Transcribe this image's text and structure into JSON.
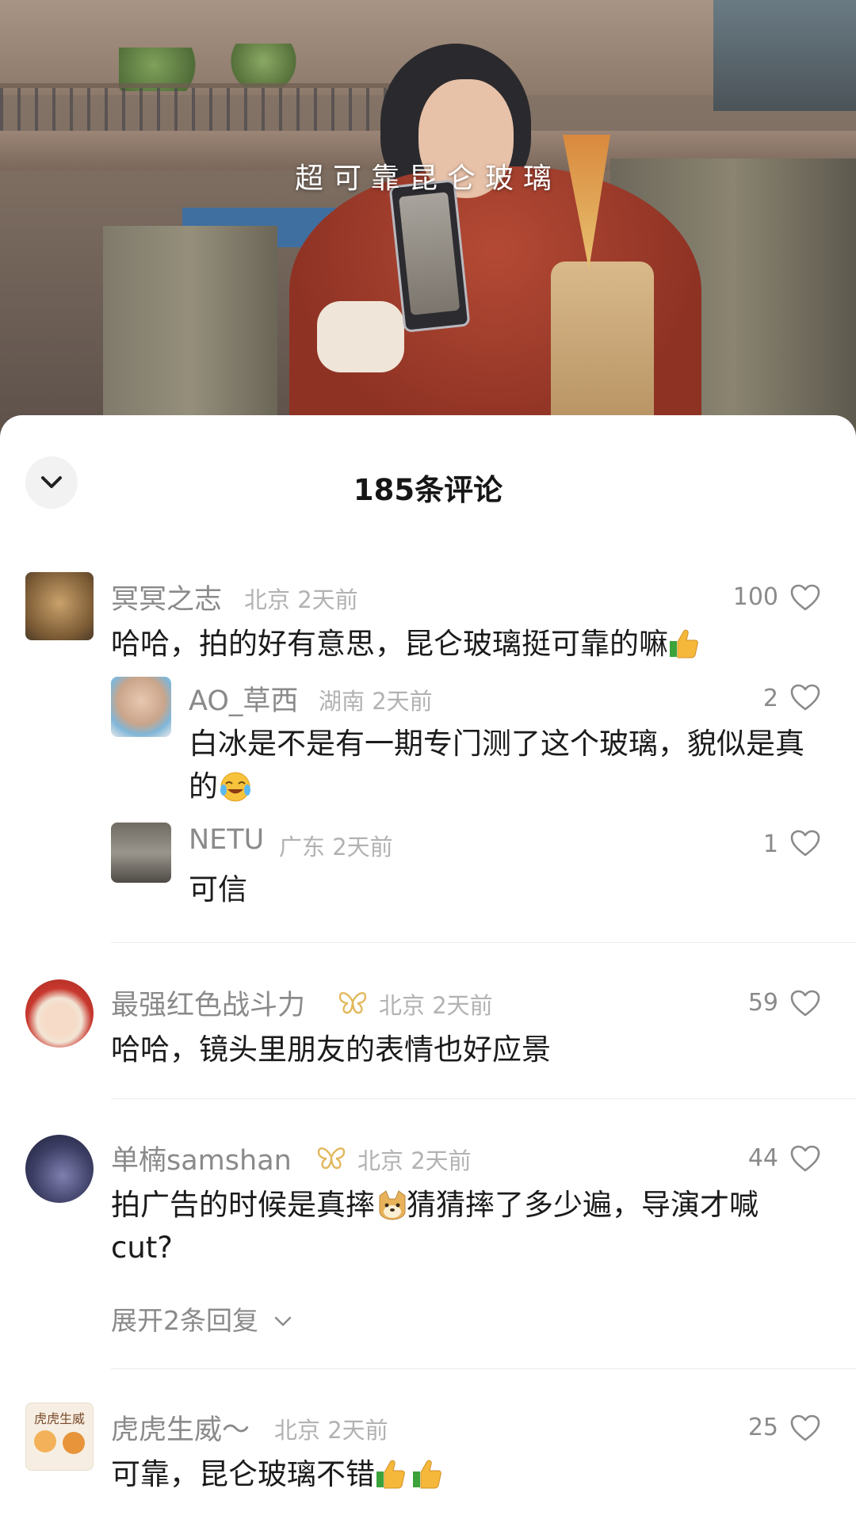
{
  "video": {
    "overlay_text": "超可靠昆仑玻璃"
  },
  "sheet": {
    "title": "185条评论"
  },
  "comments": [
    {
      "user": "冥冥之志",
      "location": "北京",
      "time": "2天前",
      "likes": "100",
      "text": "哈哈，拍的好有意思，昆仑玻璃挺可靠的嘛",
      "replies": [
        {
          "user": "AO_草西",
          "location": "湖南",
          "time": "2天前",
          "likes": "2",
          "text_line1": "白冰是不是有一期专门测了这个玻璃，貌似是真",
          "text_line2": "的"
        },
        {
          "user": "NETU",
          "location": "广东",
          "time": "2天前",
          "likes": "1",
          "text": "可信"
        }
      ]
    },
    {
      "user": "最强红色战斗力",
      "location": "北京",
      "time": "2天前",
      "likes": "59",
      "text": "哈哈，镜头里朋友的表情也好应景"
    },
    {
      "user": "单楠samshan",
      "location": "北京",
      "time": "2天前",
      "likes": "44",
      "text_part1": "拍广告的时候是真摔",
      "text_part2": "猜猜摔了多少遍，导演才喊",
      "text_line2": "cut?",
      "expand": "展开2条回复"
    },
    {
      "user": "虎虎生威～",
      "location": "北京",
      "time": "2天前",
      "likes": "25",
      "text": "可靠，昆仑玻璃不错",
      "avatar_text": "虎虎生威"
    }
  ],
  "icons": {
    "heart": "heart-outline-icon",
    "collapse": "chevron-down-icon",
    "badge": "butterfly-badge-icon"
  }
}
